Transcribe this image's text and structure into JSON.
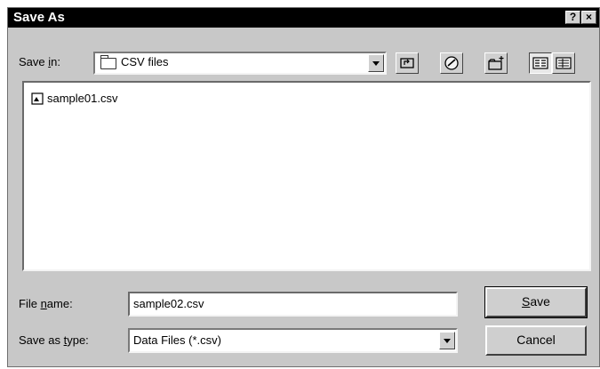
{
  "dialog": {
    "title": "Save As",
    "help_glyph": "?",
    "close_glyph": "×"
  },
  "save_in": {
    "label_pre": "Save ",
    "label_key": "i",
    "label_post": "n:",
    "value": "CSV files",
    "folder_icon": "folder-icon"
  },
  "toolbar": {
    "icons": [
      "up-one-level-icon",
      "desktop-icon",
      "new-folder-icon",
      "list-view-icon",
      "details-view-icon"
    ]
  },
  "files": [
    {
      "name": "sample01.csv",
      "icon": "file-icon"
    }
  ],
  "file_name": {
    "label_pre": "File ",
    "label_key": "n",
    "label_post": "ame:",
    "value": "sample02.csv"
  },
  "save_as_type": {
    "label_pre": "Save as ",
    "label_key": "t",
    "label_post": "ype:",
    "value": "Data Files (*.csv)"
  },
  "buttons": {
    "save_key": "S",
    "save_rest": "ave",
    "cancel": "Cancel"
  }
}
